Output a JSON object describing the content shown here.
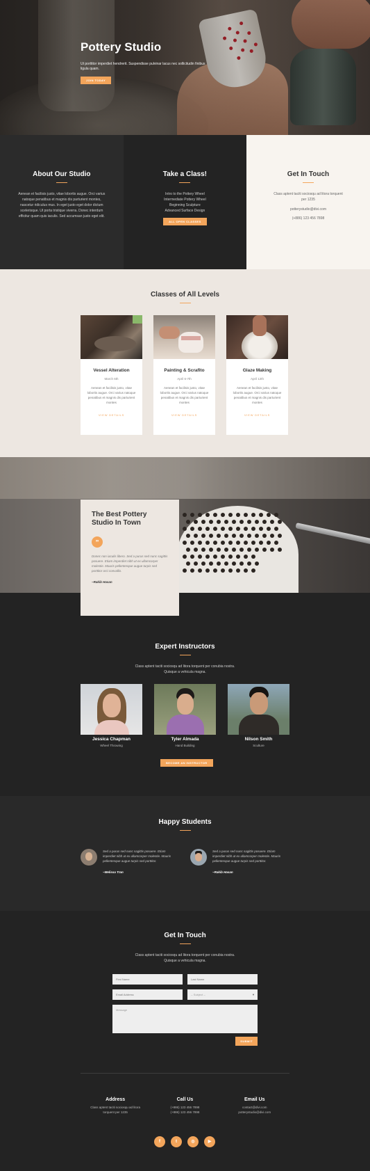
{
  "hero": {
    "title": "Pottery Studio",
    "text": "Ut porttitor imperdiet hendrerit. Suspendisse pulvinar lacus nec sollicitudin finibus ligula quam.",
    "button": "Join Today"
  },
  "info": [
    {
      "title": "About Our Studio",
      "text": "Aenean et facilisis justo, vitae lobortis augue. Orci varius natoque penatibus et magnis dis parturient montes, nascetur ridiculus mus. In eget justo eget dolor dictum scelerisque. Ut porta tristique viverra. Donec interdum efficitur quam quis iaculis. Sed accumsan justo eget elit."
    },
    {
      "title": "Take a Class!",
      "lines": [
        "Intro to the Pottery Wheel",
        "Intermediate Pottery Wheel",
        "Beginning Sculpture",
        "Advanced Surface Design"
      ],
      "button": "All Open Classes"
    },
    {
      "title": "Get In Touch",
      "text": "Class aptent taciti sociosqu ad litora torquent per 1235",
      "email": "potterystudio@divi.com",
      "phone": "(+886) 123 456 7898"
    }
  ],
  "classes": {
    "title": "Classes of All Levels",
    "items": [
      {
        "title": "Vessel Alteration",
        "date": "March 6th",
        "text": "Aenean et facilisis justo, vitae lobortis augue. Orci varius natoque penatibus et magnis dis parturient montes",
        "link": "View Details"
      },
      {
        "title": "Painting & Scrafito",
        "date": "April 6-7th",
        "text": "Aenean et facilisis justo, vitae lobortis augue. Orci varius natoque penatibus et magnis dis parturient montes",
        "link": "View Details"
      },
      {
        "title": "Glaze Making",
        "date": "April 12th",
        "text": "Aenean et facilisis justo, vitae lobortis augue. Orci varius natoque penatibus et magnis dis parturient montes",
        "link": "View Details"
      }
    ]
  },
  "quote": {
    "title": "The Best Pottery Studio In Town",
    "mark": "”",
    "text": "Donec non iaculis libero. Sed a purus sed nunc sagittis posuere. Etiam imperdiet nibh ut ex ullamcorper molestie. Mauris pellentesque augue turpis sed porttitor orci convallis.",
    "author": "~Rakib Hasan"
  },
  "instructors": {
    "title": "Expert Instructors",
    "subtitle": "Class aptent taciti sociosqu ad litora torquent per conubia nostra. Quisque a vehicula magna.",
    "people": [
      {
        "name": "Jessica Chapman",
        "role": "Wheel Throwing"
      },
      {
        "name": "Tyler Almada",
        "role": "Hand Building"
      },
      {
        "name": "Nilson Smith",
        "role": "Sculture"
      }
    ],
    "button": "Become an Instructor"
  },
  "students": {
    "title": "Happy Students",
    "items": [
      {
        "text": "Sed a purus sed nunc sagittis posuere. Etiam imperdiet nibh ut ex ullamcorper molestie. Mauris pellentesque augue turpis sed porttitor.",
        "author": "~Melissa Tran"
      },
      {
        "text": "Sed a purus sed nunc sagittis posuere. Etiam imperdiet nibh ut ex ullamcorper molestie. Mauris pellentesque augue turpis sed porttitor.",
        "author": "~Rakib Hasan"
      }
    ]
  },
  "contact": {
    "title": "Get In Touch",
    "subtitle": "Class aptent taciti sociosqu ad litora torquent per conubia nostra. Quisque a vehicula magna.",
    "first_name": "First Name",
    "last_name": "Last Name",
    "email": "Email Address",
    "subject": "-- Subject --",
    "message": "Message",
    "submit": "Submit"
  },
  "footer": {
    "cols": [
      {
        "title": "Address",
        "lines": [
          "Class aptent taciti sociosqu ad litora",
          "torquent per 1235"
        ]
      },
      {
        "title": "Call Us",
        "lines": [
          "(+886) 123 456 7898",
          "(+886) 123 456 7898"
        ]
      },
      {
        "title": "Email Us",
        "lines": [
          "contact@divi.com",
          "potterystudio@divi.com"
        ]
      }
    ],
    "socials": [
      {
        "icon": "facebook-icon",
        "glyph": "f"
      },
      {
        "icon": "twitter-icon",
        "glyph": "t"
      },
      {
        "icon": "instagram-icon",
        "glyph": "◎"
      },
      {
        "icon": "youtube-icon",
        "glyph": "▶"
      }
    ]
  },
  "colors": {
    "accent": "#f3a55b",
    "dark": "#232323",
    "cream": "#ede7e1"
  }
}
